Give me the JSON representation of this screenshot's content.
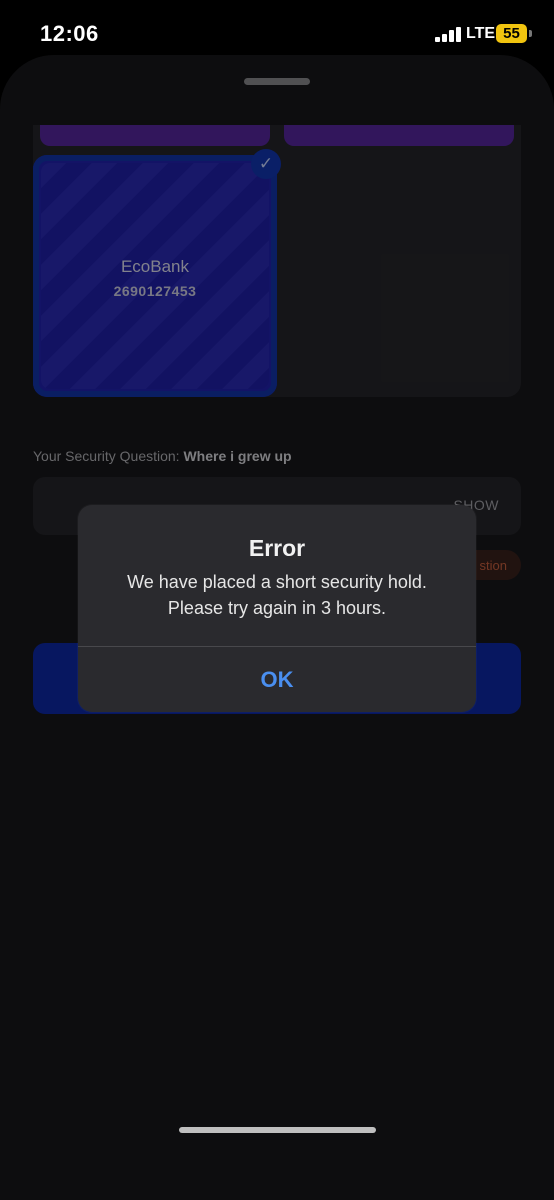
{
  "status_bar": {
    "time": "12:06",
    "network": "LTE",
    "battery": "55",
    "battery_color": "#f1c40f"
  },
  "bank_selection": {
    "selected_bank": {
      "name": "EcoBank",
      "account_number": "2690127453"
    }
  },
  "security": {
    "label_prefix": "Your Security Question: ",
    "question": "Where i grew up",
    "show_label": "SHOW",
    "link_label": "stion"
  },
  "alert": {
    "title": "Error",
    "message_line1": "We have placed a short security hold.",
    "message_line2": "Please try again in 3 hours.",
    "ok_label": "OK",
    "ok_color": "#4a8ff0"
  },
  "colors": {
    "card_selected": "#1a1a8f",
    "primary_button": "#0a1f80",
    "sheet_background": "#121214"
  }
}
